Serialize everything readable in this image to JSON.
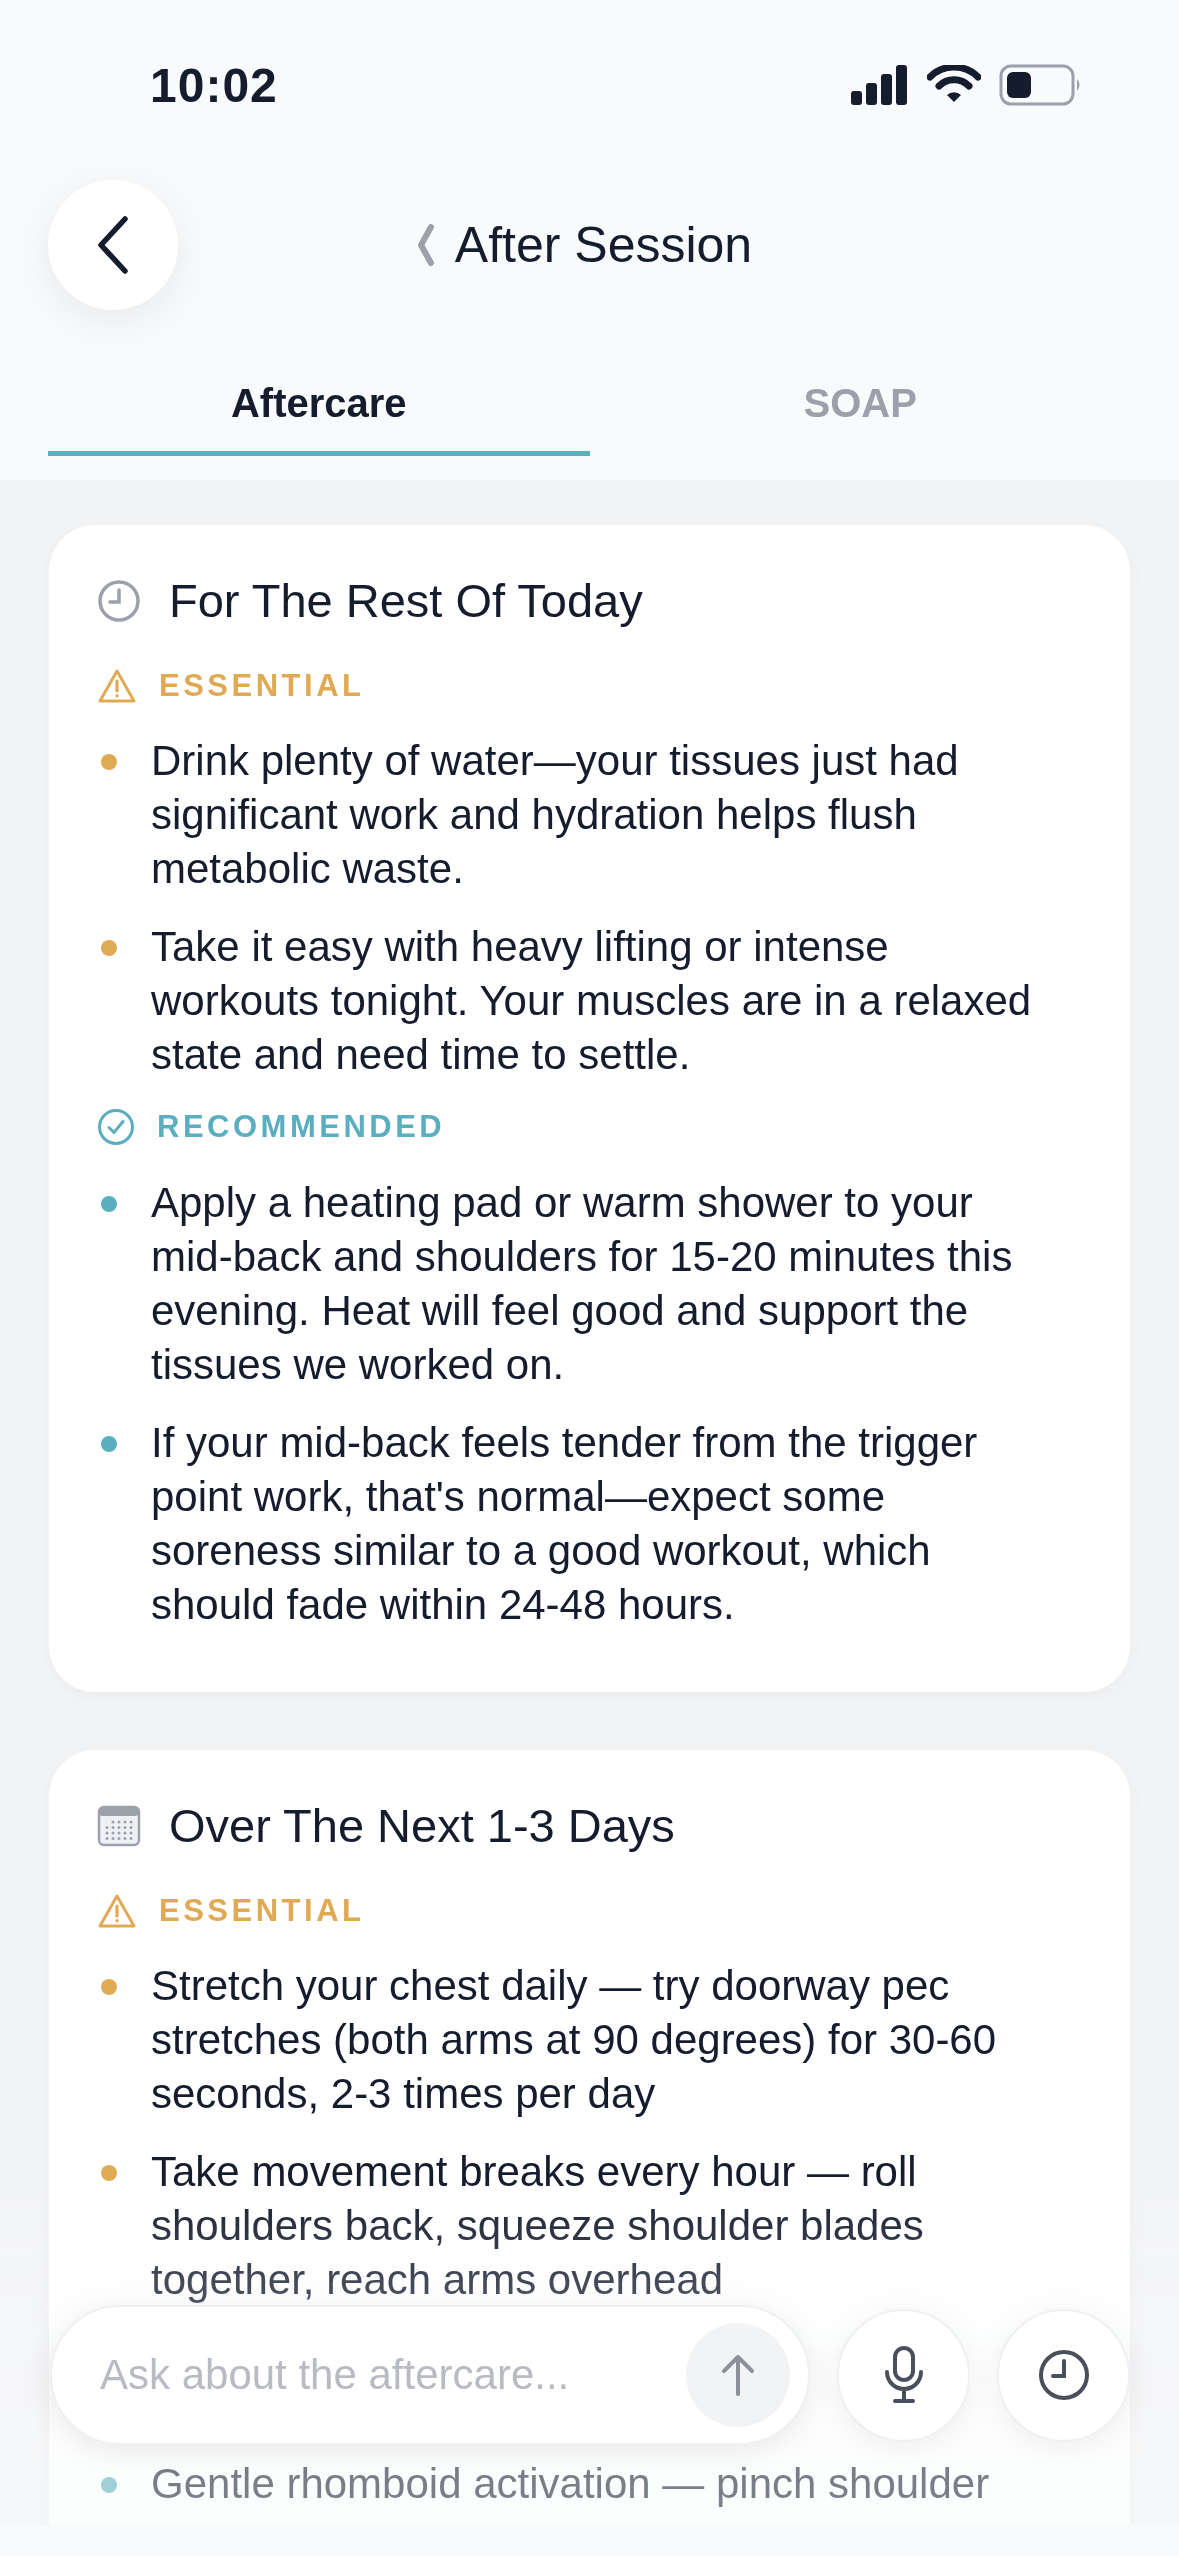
{
  "status_bar": {
    "time": "10:02"
  },
  "header": {
    "title": "After Session"
  },
  "tabs": [
    {
      "label": "Aftercare",
      "selected": true
    },
    {
      "label": "SOAP",
      "selected": false
    }
  ],
  "sections": [
    {
      "kind": "clock",
      "title": "For The Rest Of Today",
      "groups": [
        {
          "kind": "essential",
          "label": "ESSENTIAL",
          "items": [
            "Drink plenty of water—your tissues just had significant work and hydration helps flush metabolic waste.",
            "Take it easy with heavy lifting or intense workouts tonight. Your muscles are in a relaxed state and need time to settle."
          ]
        },
        {
          "kind": "recommended",
          "label": "RECOMMENDED",
          "items": [
            "Apply a heating pad or warm shower to your mid-back and shoulders for 15-20 minutes this evening. Heat will feel good and support the tissues we worked on.",
            "If your mid-back feels tender from the trigger point work, that's normal—expect some soreness similar to a good workout, which should fade within 24-48 hours."
          ]
        }
      ]
    },
    {
      "kind": "calendar",
      "title": "Over The Next 1-3 Days",
      "groups": [
        {
          "kind": "essential",
          "label": "ESSENTIAL",
          "items": [
            "Stretch your chest daily — try doorway pec stretches (both arms at 90 degrees) for 30-60 seconds, 2-3 times per day",
            "Take movement breaks every hour — roll shoulders back, squeeze shoulder blades together, reach arms overhead"
          ]
        },
        {
          "kind": "recommended",
          "items": [
            "Gentle rhomboid activation — pinch shoulder"
          ]
        }
      ]
    }
  ],
  "composer": {
    "placeholder": "Ask about the aftercare..."
  }
}
